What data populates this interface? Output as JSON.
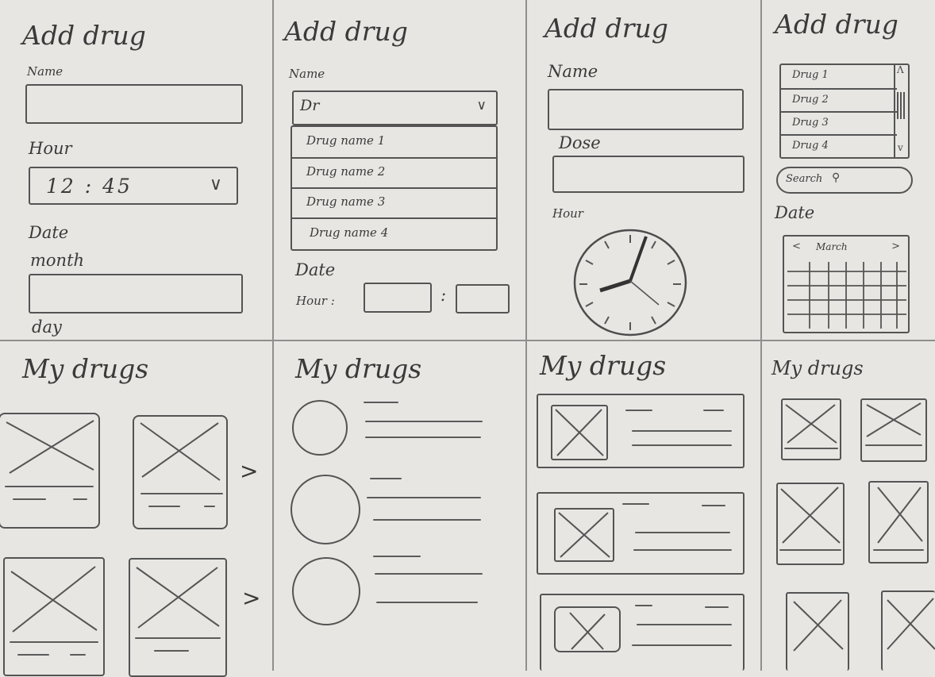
{
  "sketch_1": {
    "title": "Add drug",
    "name_label": "Name",
    "hour_label": "Hour",
    "hour_value": "12 : 45",
    "date_label": "Date",
    "month_label": "month",
    "day_label": "day",
    "dropdown_icon": "chevron-down-icon"
  },
  "sketch_2": {
    "title": "Add drug",
    "name_label": "Name",
    "name_value": "Dr",
    "options": [
      "Drug name 1",
      "Drug name 2",
      "Drug name 3",
      "Drug name 4"
    ],
    "date_label": "Date",
    "hour_label": "Hour :",
    "time_separator": ":"
  },
  "sketch_3": {
    "title": "Add drug",
    "name_label": "Name",
    "dose_label": "Dose",
    "hour_label": "Hour",
    "clock_icon": "clock-icon"
  },
  "sketch_4": {
    "title": "Add drug",
    "list_items": [
      "Drug 1",
      "Drug 2",
      "Drug 3",
      "Drug 4"
    ],
    "search_label": "Search",
    "date_label": "Date",
    "month_label": "March",
    "prev_icon": "chevron-left-icon",
    "next_icon": "chevron-right-icon"
  },
  "my_drugs": {
    "title_1": "My drugs",
    "title_2": "My drugs",
    "title_3": "My drugs",
    "title_4": "My drugs",
    "next_glyph": ">"
  }
}
